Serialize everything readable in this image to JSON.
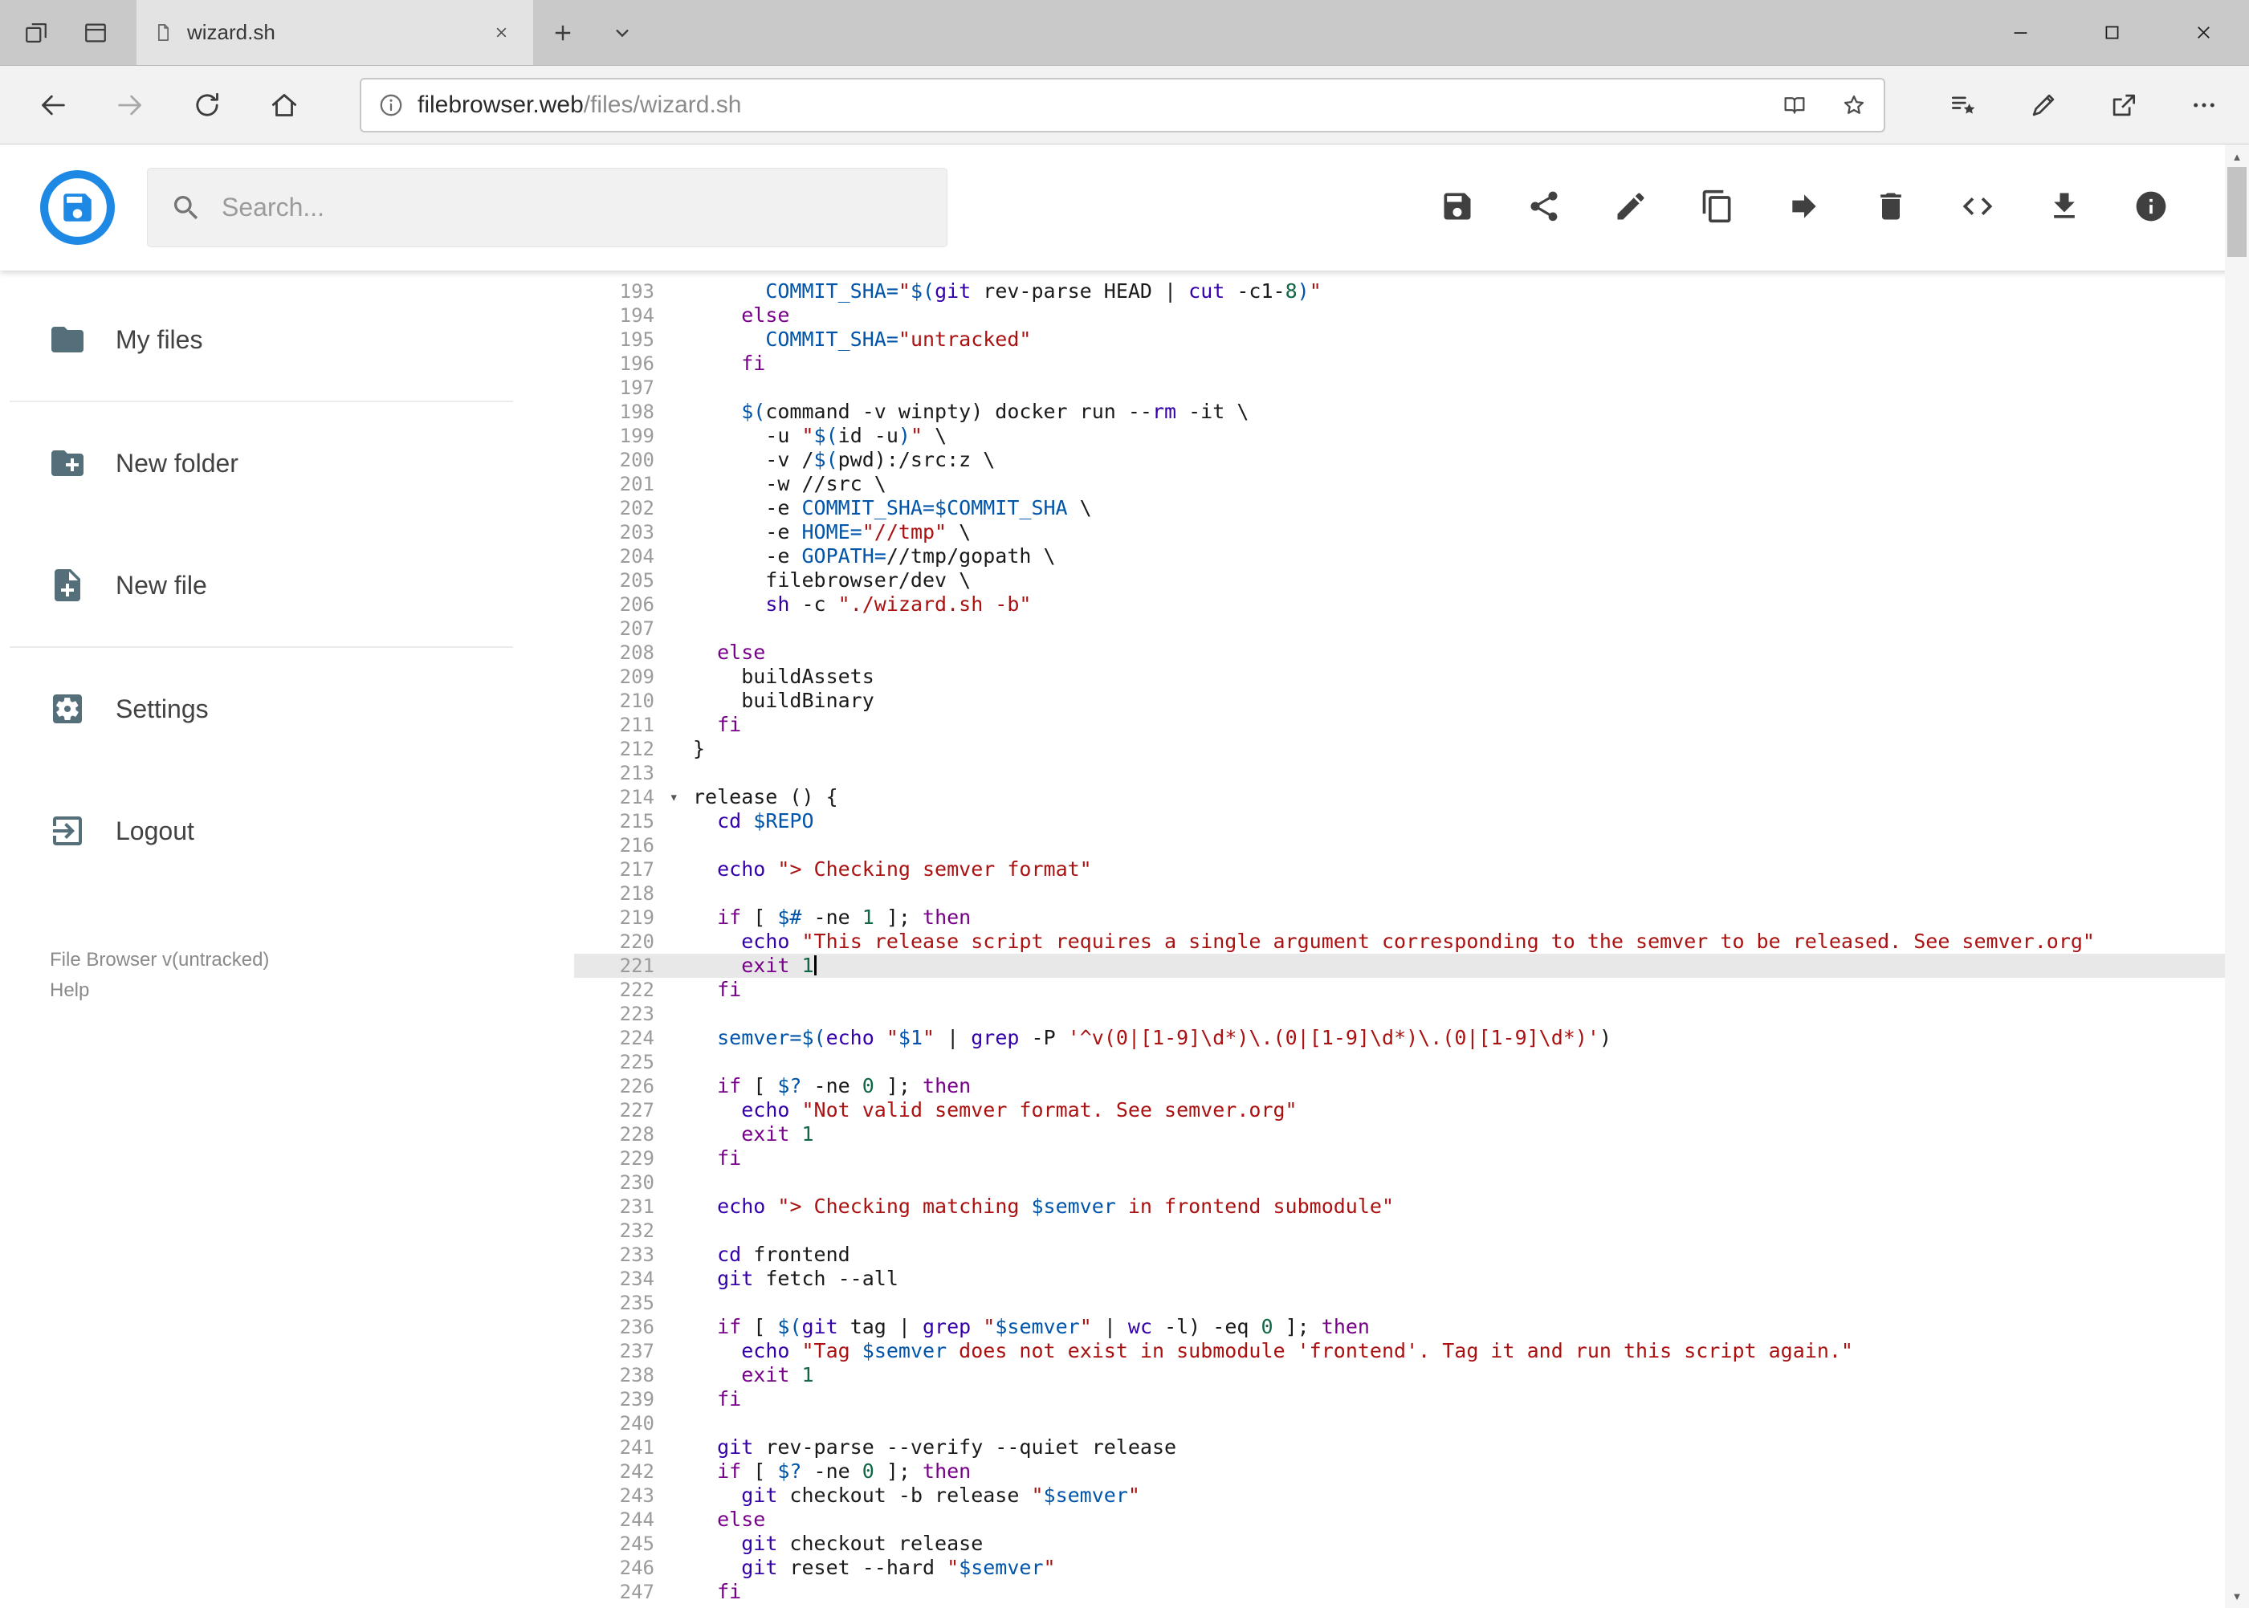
{
  "theme": {
    "accent": "#1E88E5",
    "syntax": {
      "keyword": "#770088",
      "string": "#aa1111",
      "variable": "#0055aa",
      "number": "#116644",
      "builtin": "#3300aa"
    }
  },
  "browser": {
    "tab": {
      "title": "wizard.sh"
    },
    "address": {
      "host": "filebrowser.web",
      "path": "/files/wizard.sh"
    }
  },
  "app": {
    "search": {
      "placeholder": "Search..."
    },
    "toolbar": [
      {
        "name": "save",
        "icon": "save"
      },
      {
        "name": "share",
        "icon": "share"
      },
      {
        "name": "rename",
        "icon": "pencil"
      },
      {
        "name": "copy",
        "icon": "copy"
      },
      {
        "name": "move",
        "icon": "forward"
      },
      {
        "name": "delete",
        "icon": "delete"
      },
      {
        "name": "raw-code",
        "icon": "code"
      },
      {
        "name": "download",
        "icon": "download"
      },
      {
        "name": "info",
        "icon": "info"
      }
    ],
    "sidebar": {
      "items": [
        {
          "label": "My files",
          "icon": "folder"
        },
        {
          "label": "New folder",
          "icon": "folder-plus"
        },
        {
          "label": "New file",
          "icon": "file-plus"
        },
        {
          "label": "Settings",
          "icon": "settings"
        },
        {
          "label": "Logout",
          "icon": "logout"
        }
      ],
      "dividers_after": [
        0,
        2
      ],
      "version": "File Browser v(untracked)",
      "help": "Help"
    },
    "editor": {
      "first_line": 193,
      "active_line": 221,
      "fold_marker_line": 214,
      "cursor": {
        "line": 221,
        "column": 10
      },
      "lines": [
        "      COMMIT_SHA=\"$(git rev-parse HEAD | cut -c1-8)\"",
        "    else",
        "      COMMIT_SHA=\"untracked\"",
        "    fi",
        "",
        "    $(command -v winpty) docker run --rm -it \\",
        "      -u \"$(id -u)\" \\",
        "      -v /$(pwd):/src:z \\",
        "      -w //src \\",
        "      -e COMMIT_SHA=$COMMIT_SHA \\",
        "      -e HOME=\"//tmp\" \\",
        "      -e GOPATH=//tmp/gopath \\",
        "      filebrowser/dev \\",
        "      sh -c \"./wizard.sh -b\"",
        "",
        "  else",
        "    buildAssets",
        "    buildBinary",
        "  fi",
        "}",
        "",
        "release () {",
        "  cd $REPO",
        "",
        "  echo \"> Checking semver format\"",
        "",
        "  if [ $# -ne 1 ]; then",
        "    echo \"This release script requires a single argument corresponding to the semver to be released. See semver.org\"",
        "    exit 1",
        "  fi",
        "",
        "  semver=$(echo \"$1\" | grep -P '^v(0|[1-9]\\d*)\\.(0|[1-9]\\d*)\\.(0|[1-9]\\d*)')",
        "",
        "  if [ $? -ne 0 ]; then",
        "    echo \"Not valid semver format. See semver.org\"",
        "    exit 1",
        "  fi",
        "",
        "  echo \"> Checking matching $semver in frontend submodule\"",
        "",
        "  cd frontend",
        "  git fetch --all",
        "",
        "  if [ $(git tag | grep \"$semver\" | wc -l) -eq 0 ]; then",
        "    echo \"Tag $semver does not exist in submodule 'frontend'. Tag it and run this script again.\"",
        "    exit 1",
        "  fi",
        "",
        "  git rev-parse --verify --quiet release",
        "  if [ $? -ne 0 ]; then",
        "    git checkout -b release \"$semver\"",
        "  else",
        "    git checkout release",
        "    git reset --hard \"$semver\"",
        "  fi"
      ]
    }
  }
}
